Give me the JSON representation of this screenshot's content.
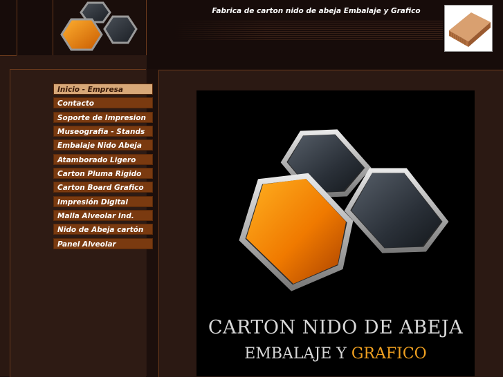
{
  "site": {
    "title": "Fabrica de carton nido de abeja Embalaje y Grafico"
  },
  "nav": {
    "items": [
      {
        "label": "Inicio - Empresa",
        "active": true
      },
      {
        "label": "Contacto"
      },
      {
        "label": "Soporte de Impresion"
      },
      {
        "label": "Museografia - Stands"
      },
      {
        "label": "Embalaje Nido Abeja"
      },
      {
        "label": "Atamborado Ligero"
      },
      {
        "label": "Carton Pluma Rigido"
      },
      {
        "label": "Carton Board Grafico"
      },
      {
        "label": "Impresión Digital"
      },
      {
        "label": "Malla Alveolar Ind."
      },
      {
        "label": "Nido de Abeja cartón"
      },
      {
        "label": "Panel Alveolar"
      }
    ]
  },
  "banner": {
    "line1": "CARTON NIDO DE ABEJA",
    "line2_word1": "EMBALAJE Y",
    "line2_word2": "GRAFICO"
  },
  "colors": {
    "background": "#1c0f0c",
    "frame_border": "#6a3a1c",
    "nav_item": "#7a3a10",
    "nav_active": "#d8a878",
    "accent_orange": "#f0a020"
  }
}
